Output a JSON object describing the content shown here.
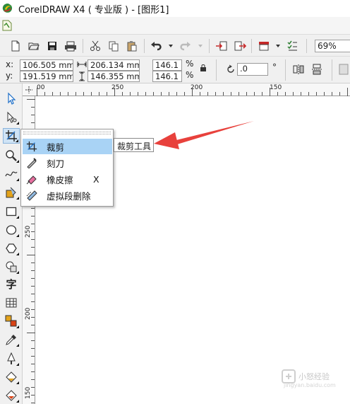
{
  "window": {
    "title": "CorelDRAW X4 ( 专业版 ) - [图形1]"
  },
  "toolbar": {
    "zoom_value": "69%",
    "icons": [
      "new-document-icon",
      "open-icon",
      "save-icon",
      "print-icon",
      "cut-icon",
      "copy-icon",
      "paste-icon",
      "undo-icon",
      "redo-icon",
      "import-icon",
      "export-icon",
      "application-launcher-icon",
      "options-icon"
    ]
  },
  "property_bar": {
    "x_label": "x:",
    "x_value": "106.505 mm",
    "y_label": "y:",
    "y_value": "191.519 mm",
    "width_value": "206.134 mm",
    "height_value": "146.355 mm",
    "scale_x": "146.1",
    "scale_y": "146.1",
    "percent_1": "%",
    "percent_2": "%",
    "rotation_value": ".0",
    "degree": "°"
  },
  "rulers": {
    "h_labels": [
      "00",
      "250",
      "200",
      "150"
    ],
    "v_labels": [
      "250",
      "200",
      "150"
    ]
  },
  "toolbox": {
    "text_tool_glyph": "字",
    "tools": [
      "pick-tool",
      "shape-tool",
      "crop-tool",
      "zoom-tool",
      "freehand-tool",
      "smart-fill-tool",
      "rectangle-tool",
      "ellipse-tool",
      "polygon-tool",
      "basic-shapes-tool",
      "text-tool",
      "table-tool",
      "interactive-blend-tool",
      "eyedropper-tool",
      "outline-tool",
      "fill-tool",
      "interactive-fill-tool"
    ]
  },
  "flyout": {
    "items": [
      {
        "label": "裁剪",
        "shortcut": ""
      },
      {
        "label": "刻刀",
        "shortcut": ""
      },
      {
        "label": "橡皮擦",
        "shortcut": "X"
      },
      {
        "label": "虚拟段删除",
        "shortcut": ""
      }
    ]
  },
  "tooltip": {
    "text": "裁剪工具"
  },
  "colors": {
    "highlight": "#a9d3f5",
    "arrow": "#e8413c",
    "chrome": "#f0f0f0"
  },
  "watermark": {
    "text": "小怒经验",
    "url": "jingyan.baidu.com"
  }
}
